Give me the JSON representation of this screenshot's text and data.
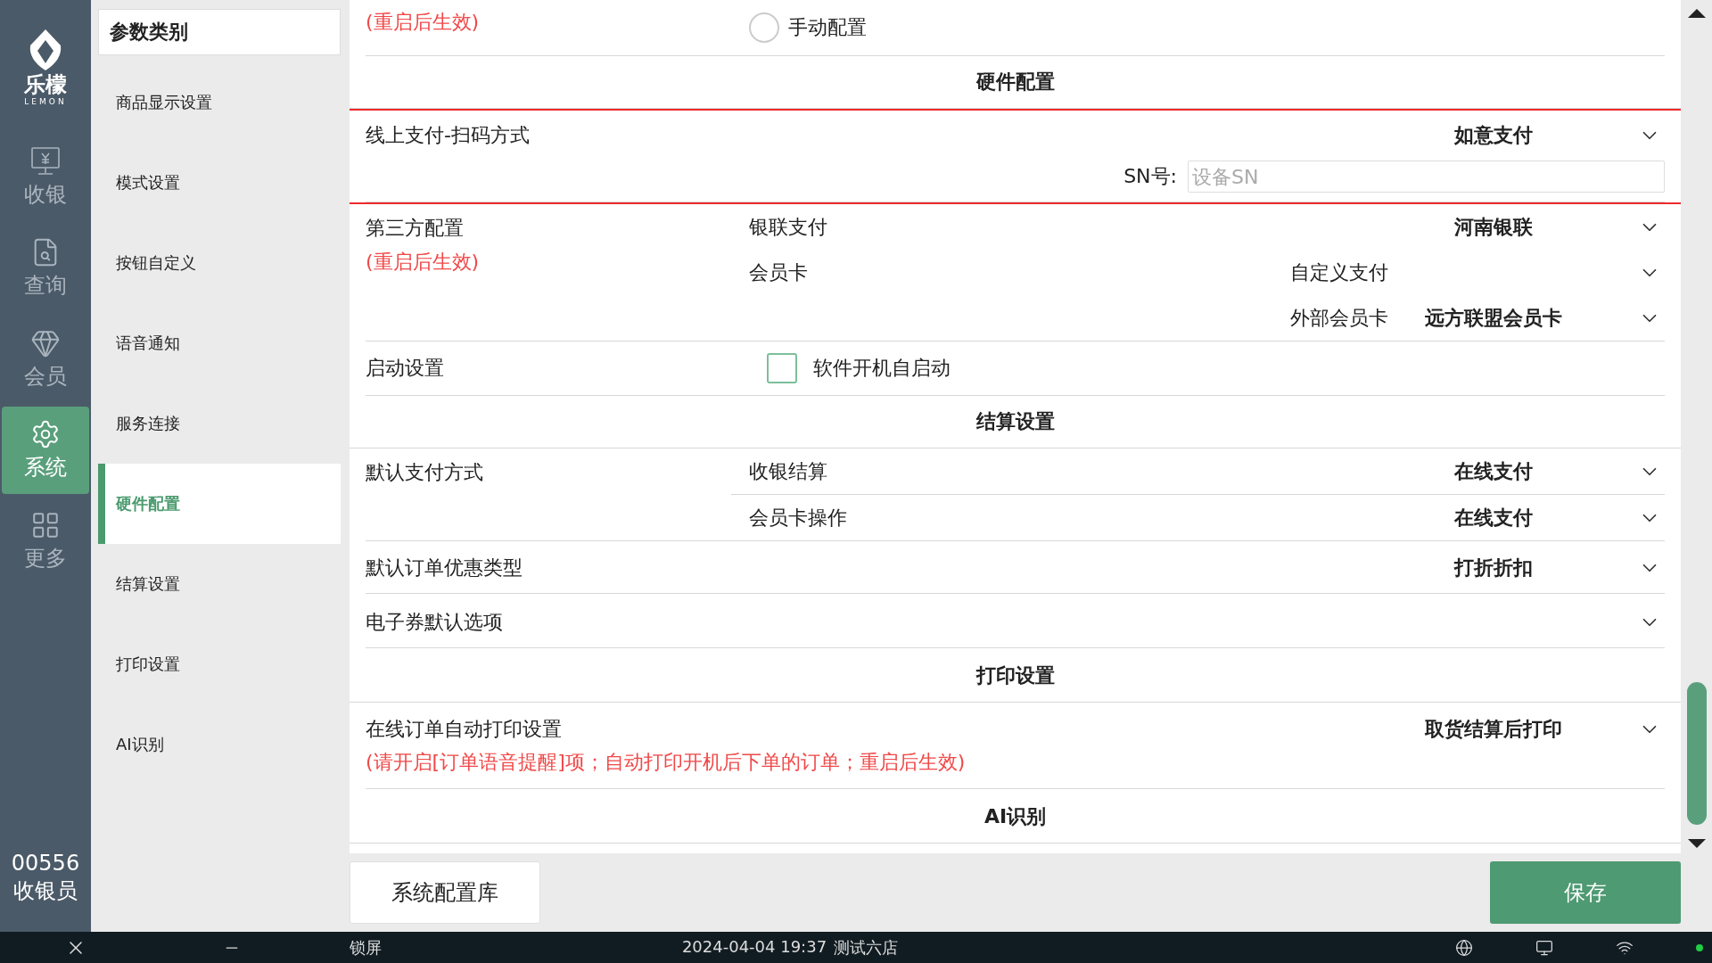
{
  "nav": {
    "logo_text": "乐檬",
    "logo_sub": "LEMON",
    "items": [
      {
        "label": "收银",
        "selected": false
      },
      {
        "label": "查询",
        "selected": false
      },
      {
        "label": "会员",
        "selected": false
      },
      {
        "label": "系统",
        "selected": true
      },
      {
        "label": "更多",
        "selected": false
      }
    ],
    "user_id": "00556",
    "user_role": "收银员"
  },
  "categories": {
    "title": "参数类别",
    "items": [
      {
        "label": "商品显示设置",
        "selected": false
      },
      {
        "label": "模式设置",
        "selected": false
      },
      {
        "label": "按钮自定义",
        "selected": false
      },
      {
        "label": "语音通知",
        "selected": false
      },
      {
        "label": "服务连接",
        "selected": false
      },
      {
        "label": "硬件配置",
        "selected": true
      },
      {
        "label": "结算设置",
        "selected": false
      },
      {
        "label": "打印设置",
        "selected": false
      },
      {
        "label": "AI识别",
        "selected": false
      }
    ]
  },
  "rows": [
    {
      "kind": "radio",
      "note": "(重启后生效)",
      "option": "手动配置",
      "selected": false
    },
    {
      "kind": "header",
      "title": "硬件配置"
    },
    {
      "kind": "select",
      "label": "线上支付-扫码方式",
      "value": "如意支付",
      "highlighted": true,
      "sn": {
        "label": "SN号:",
        "placeholder": "设备SN"
      }
    },
    {
      "kind": "group",
      "label": "第三方配置",
      "note": "(重启后生效)",
      "items": [
        {
          "name": "银联支付",
          "value": "河南银联"
        },
        {
          "name": "会员卡",
          "option": "自定义支付"
        },
        {
          "option": "外部会员卡",
          "value": "远方联盟会员卡"
        }
      ]
    },
    {
      "kind": "checkbox",
      "label": "启动设置",
      "option": "软件开机自启动",
      "checked": false
    },
    {
      "kind": "header",
      "title": "结算设置"
    },
    {
      "kind": "group",
      "label": "默认支付方式",
      "dividers": true,
      "items": [
        {
          "name": "收银结算",
          "value": "在线支付"
        },
        {
          "name": "会员卡操作",
          "value": "在线支付"
        }
      ]
    },
    {
      "kind": "select",
      "label": "默认订单优惠类型",
      "value": "打折折扣",
      "highlighted": false
    },
    {
      "kind": "select",
      "label": "电子券默认选项",
      "highlighted": false
    },
    {
      "kind": "header",
      "title": "打印设置"
    },
    {
      "kind": "select",
      "label": "在线订单自动打印设置",
      "value": "取货结算后打印",
      "highlighted": false,
      "note": "(请开启[订单语音提醒]项；自动打印开机后下单的订单；重启后生效)"
    },
    {
      "kind": "header",
      "title": "AI识别"
    }
  ],
  "footer": {
    "library_button": "系统配置库",
    "save_button": "保存"
  },
  "taskbar": {
    "lock": "锁屏",
    "datetime": "2024-04-04 19:37",
    "store": "测试六店"
  }
}
